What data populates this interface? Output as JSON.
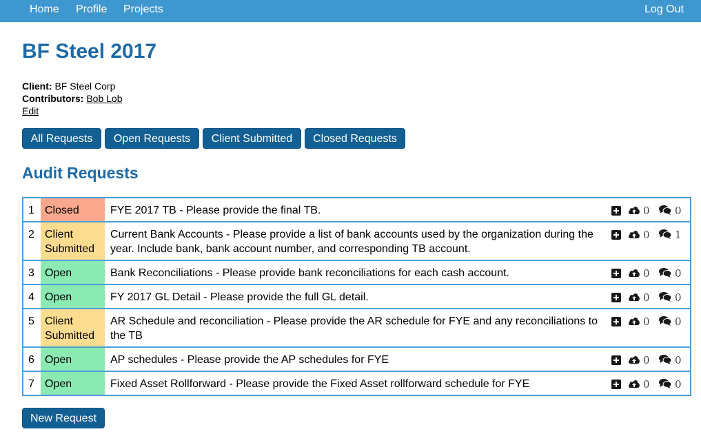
{
  "nav": {
    "home": "Home",
    "profile": "Profile",
    "projects": "Projects",
    "logout": "Log Out"
  },
  "project": {
    "title": "BF Steel 2017",
    "client_label": "Client:",
    "client_value": "BF Steel Corp",
    "contributors_label": "Contributors:",
    "contributors_value": "Bob Lob",
    "edit_link": "Edit"
  },
  "filters": {
    "all": "All Requests",
    "open": "Open Requests",
    "client_submitted": "Client Submitted",
    "closed": "Closed Requests"
  },
  "section_title": "Audit Requests",
  "status_colors": {
    "Closed": "#f9a88d",
    "Client Submitted": "#fcdc8f",
    "Open": "#8be9b3"
  },
  "requests": [
    {
      "num": "1",
      "status": "Closed",
      "text": "FYE 2017 TB - Please provide the final TB.",
      "uploads": "0",
      "comments": "0"
    },
    {
      "num": "2",
      "status": "Client Submitted",
      "text": "Current Bank Accounts - Please provide a list of bank accounts used by the organization during the year. Include bank, bank account number, and corresponding TB account.",
      "uploads": "0",
      "comments": "1"
    },
    {
      "num": "3",
      "status": "Open",
      "text": "Bank Reconciliations - Please provide bank reconciliations for each cash account.",
      "uploads": "0",
      "comments": "0"
    },
    {
      "num": "4",
      "status": "Open",
      "text": "FY 2017 GL Detail - Please provide the full GL detail.",
      "uploads": "0",
      "comments": "0"
    },
    {
      "num": "5",
      "status": "Client Submitted",
      "text": "AR Schedule and reconciliation - Please provide the AR schedule for FYE and any reconciliations to the TB",
      "uploads": "0",
      "comments": "0"
    },
    {
      "num": "6",
      "status": "Open",
      "text": "AP schedules - Please provide the AP schedules for FYE",
      "uploads": "0",
      "comments": "0"
    },
    {
      "num": "7",
      "status": "Open",
      "text": "Fixed Asset Rollforward - Please provide the Fixed Asset rollforward schedule for FYE",
      "uploads": "0",
      "comments": "0"
    }
  ],
  "new_request": "New Request"
}
